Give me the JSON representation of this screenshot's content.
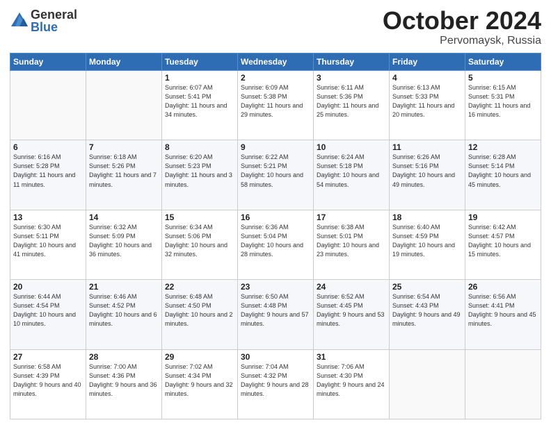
{
  "header": {
    "logo_general": "General",
    "logo_blue": "Blue",
    "title": "October 2024",
    "location": "Pervomaysk, Russia"
  },
  "days_of_week": [
    "Sunday",
    "Monday",
    "Tuesday",
    "Wednesday",
    "Thursday",
    "Friday",
    "Saturday"
  ],
  "weeks": [
    [
      {
        "day": "",
        "sunrise": "",
        "sunset": "",
        "daylight": ""
      },
      {
        "day": "",
        "sunrise": "",
        "sunset": "",
        "daylight": ""
      },
      {
        "day": "1",
        "sunrise": "Sunrise: 6:07 AM",
        "sunset": "Sunset: 5:41 PM",
        "daylight": "Daylight: 11 hours and 34 minutes."
      },
      {
        "day": "2",
        "sunrise": "Sunrise: 6:09 AM",
        "sunset": "Sunset: 5:38 PM",
        "daylight": "Daylight: 11 hours and 29 minutes."
      },
      {
        "day": "3",
        "sunrise": "Sunrise: 6:11 AM",
        "sunset": "Sunset: 5:36 PM",
        "daylight": "Daylight: 11 hours and 25 minutes."
      },
      {
        "day": "4",
        "sunrise": "Sunrise: 6:13 AM",
        "sunset": "Sunset: 5:33 PM",
        "daylight": "Daylight: 11 hours and 20 minutes."
      },
      {
        "day": "5",
        "sunrise": "Sunrise: 6:15 AM",
        "sunset": "Sunset: 5:31 PM",
        "daylight": "Daylight: 11 hours and 16 minutes."
      }
    ],
    [
      {
        "day": "6",
        "sunrise": "Sunrise: 6:16 AM",
        "sunset": "Sunset: 5:28 PM",
        "daylight": "Daylight: 11 hours and 11 minutes."
      },
      {
        "day": "7",
        "sunrise": "Sunrise: 6:18 AM",
        "sunset": "Sunset: 5:26 PM",
        "daylight": "Daylight: 11 hours and 7 minutes."
      },
      {
        "day": "8",
        "sunrise": "Sunrise: 6:20 AM",
        "sunset": "Sunset: 5:23 PM",
        "daylight": "Daylight: 11 hours and 3 minutes."
      },
      {
        "day": "9",
        "sunrise": "Sunrise: 6:22 AM",
        "sunset": "Sunset: 5:21 PM",
        "daylight": "Daylight: 10 hours and 58 minutes."
      },
      {
        "day": "10",
        "sunrise": "Sunrise: 6:24 AM",
        "sunset": "Sunset: 5:18 PM",
        "daylight": "Daylight: 10 hours and 54 minutes."
      },
      {
        "day": "11",
        "sunrise": "Sunrise: 6:26 AM",
        "sunset": "Sunset: 5:16 PM",
        "daylight": "Daylight: 10 hours and 49 minutes."
      },
      {
        "day": "12",
        "sunrise": "Sunrise: 6:28 AM",
        "sunset": "Sunset: 5:14 PM",
        "daylight": "Daylight: 10 hours and 45 minutes."
      }
    ],
    [
      {
        "day": "13",
        "sunrise": "Sunrise: 6:30 AM",
        "sunset": "Sunset: 5:11 PM",
        "daylight": "Daylight: 10 hours and 41 minutes."
      },
      {
        "day": "14",
        "sunrise": "Sunrise: 6:32 AM",
        "sunset": "Sunset: 5:09 PM",
        "daylight": "Daylight: 10 hours and 36 minutes."
      },
      {
        "day": "15",
        "sunrise": "Sunrise: 6:34 AM",
        "sunset": "Sunset: 5:06 PM",
        "daylight": "Daylight: 10 hours and 32 minutes."
      },
      {
        "day": "16",
        "sunrise": "Sunrise: 6:36 AM",
        "sunset": "Sunset: 5:04 PM",
        "daylight": "Daylight: 10 hours and 28 minutes."
      },
      {
        "day": "17",
        "sunrise": "Sunrise: 6:38 AM",
        "sunset": "Sunset: 5:01 PM",
        "daylight": "Daylight: 10 hours and 23 minutes."
      },
      {
        "day": "18",
        "sunrise": "Sunrise: 6:40 AM",
        "sunset": "Sunset: 4:59 PM",
        "daylight": "Daylight: 10 hours and 19 minutes."
      },
      {
        "day": "19",
        "sunrise": "Sunrise: 6:42 AM",
        "sunset": "Sunset: 4:57 PM",
        "daylight": "Daylight: 10 hours and 15 minutes."
      }
    ],
    [
      {
        "day": "20",
        "sunrise": "Sunrise: 6:44 AM",
        "sunset": "Sunset: 4:54 PM",
        "daylight": "Daylight: 10 hours and 10 minutes."
      },
      {
        "day": "21",
        "sunrise": "Sunrise: 6:46 AM",
        "sunset": "Sunset: 4:52 PM",
        "daylight": "Daylight: 10 hours and 6 minutes."
      },
      {
        "day": "22",
        "sunrise": "Sunrise: 6:48 AM",
        "sunset": "Sunset: 4:50 PM",
        "daylight": "Daylight: 10 hours and 2 minutes."
      },
      {
        "day": "23",
        "sunrise": "Sunrise: 6:50 AM",
        "sunset": "Sunset: 4:48 PM",
        "daylight": "Daylight: 9 hours and 57 minutes."
      },
      {
        "day": "24",
        "sunrise": "Sunrise: 6:52 AM",
        "sunset": "Sunset: 4:45 PM",
        "daylight": "Daylight: 9 hours and 53 minutes."
      },
      {
        "day": "25",
        "sunrise": "Sunrise: 6:54 AM",
        "sunset": "Sunset: 4:43 PM",
        "daylight": "Daylight: 9 hours and 49 minutes."
      },
      {
        "day": "26",
        "sunrise": "Sunrise: 6:56 AM",
        "sunset": "Sunset: 4:41 PM",
        "daylight": "Daylight: 9 hours and 45 minutes."
      }
    ],
    [
      {
        "day": "27",
        "sunrise": "Sunrise: 6:58 AM",
        "sunset": "Sunset: 4:39 PM",
        "daylight": "Daylight: 9 hours and 40 minutes."
      },
      {
        "day": "28",
        "sunrise": "Sunrise: 7:00 AM",
        "sunset": "Sunset: 4:36 PM",
        "daylight": "Daylight: 9 hours and 36 minutes."
      },
      {
        "day": "29",
        "sunrise": "Sunrise: 7:02 AM",
        "sunset": "Sunset: 4:34 PM",
        "daylight": "Daylight: 9 hours and 32 minutes."
      },
      {
        "day": "30",
        "sunrise": "Sunrise: 7:04 AM",
        "sunset": "Sunset: 4:32 PM",
        "daylight": "Daylight: 9 hours and 28 minutes."
      },
      {
        "day": "31",
        "sunrise": "Sunrise: 7:06 AM",
        "sunset": "Sunset: 4:30 PM",
        "daylight": "Daylight: 9 hours and 24 minutes."
      },
      {
        "day": "",
        "sunrise": "",
        "sunset": "",
        "daylight": ""
      },
      {
        "day": "",
        "sunrise": "",
        "sunset": "",
        "daylight": ""
      }
    ]
  ]
}
